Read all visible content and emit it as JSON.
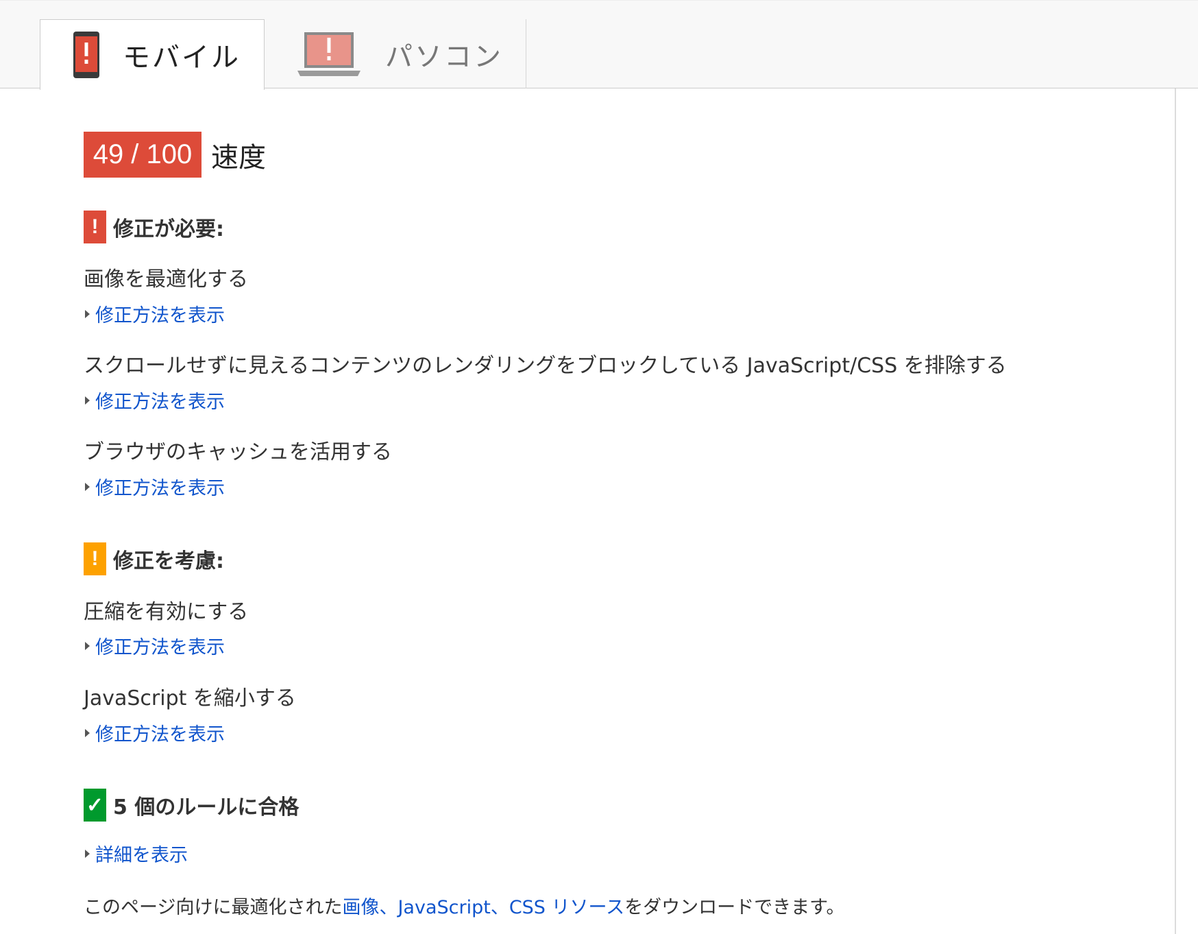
{
  "tabs": [
    {
      "label": "モバイル",
      "icon": "mobile-phone-warning-icon",
      "active": true
    },
    {
      "label": "パソコン",
      "icon": "laptop-warning-icon",
      "active": false
    }
  ],
  "score": {
    "value": "49 / 100",
    "label": "速度",
    "color": "#dd4b39"
  },
  "sections": {
    "should_fix": {
      "title": "修正が必要:",
      "icon": "red-exclamation-icon",
      "color": "#dd4b39",
      "rules": [
        {
          "title": "画像を最適化する",
          "link": "修正方法を表示"
        },
        {
          "title": "スクロールせずに見えるコンテンツのレンダリングをブロックしている JavaScript/CSS を排除する",
          "link": "修正方法を表示"
        },
        {
          "title": "ブラウザのキャッシュを活用する",
          "link": "修正方法を表示"
        }
      ]
    },
    "consider_fix": {
      "title": "修正を考慮:",
      "icon": "orange-exclamation-icon",
      "color": "#fda100",
      "rules": [
        {
          "title": "圧縮を有効にする",
          "link": "修正方法を表示"
        },
        {
          "title": "JavaScript を縮小する",
          "link": "修正方法を表示"
        }
      ]
    },
    "passed": {
      "title": "5 個のルールに合格",
      "icon": "green-check-icon",
      "color": "#009a2d",
      "link": "詳細を表示"
    }
  },
  "footer": {
    "prefix": "このページ向けに最適化された",
    "link_images": "画像",
    "sep1": "、",
    "link_js": "JavaScript",
    "sep2": "、",
    "link_css": "CSS リソース",
    "suffix": "をダウンロードできます。"
  }
}
